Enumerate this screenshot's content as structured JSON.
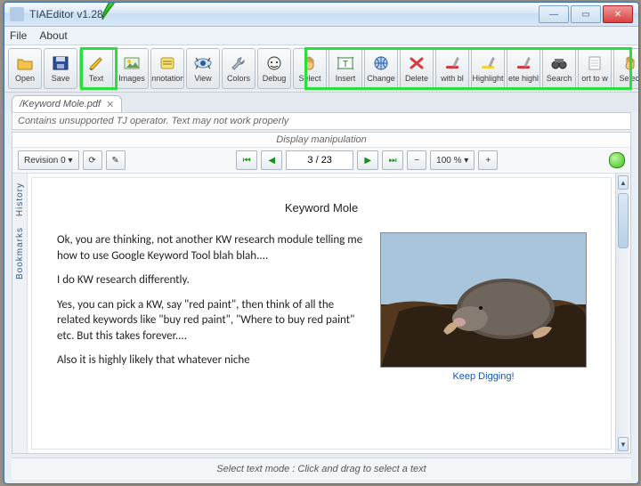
{
  "window": {
    "title": "TIAEditor v1.28",
    "buttons": {
      "min": "—",
      "max": "▭",
      "close": "✕"
    }
  },
  "menu": {
    "file": "File",
    "about": "About"
  },
  "toolbar": {
    "primary": [
      {
        "id": "open",
        "label": "Open",
        "icon": "folder"
      },
      {
        "id": "save",
        "label": "Save",
        "icon": "floppy"
      },
      {
        "id": "text",
        "label": "Text",
        "icon": "pencil"
      },
      {
        "id": "images",
        "label": "Images",
        "icon": "picture"
      },
      {
        "id": "annotations",
        "label": "Annotations",
        "icon": "note"
      },
      {
        "id": "view",
        "label": "View",
        "icon": "eye"
      },
      {
        "id": "colors",
        "label": "Colors",
        "icon": "wrench"
      },
      {
        "id": "debug",
        "label": "Debug",
        "icon": "face"
      }
    ],
    "secondary": [
      {
        "id": "select",
        "label": "Select",
        "icon": "hand"
      },
      {
        "id": "insert",
        "label": "Insert",
        "icon": "textbox"
      },
      {
        "id": "change",
        "label": "Change",
        "icon": "globe"
      },
      {
        "id": "delete",
        "label": "Delete",
        "icon": "cross"
      },
      {
        "id": "withbl",
        "label": "with bl",
        "icon": "wand-red"
      },
      {
        "id": "highlight",
        "label": "Highlight",
        "icon": "wand-yel"
      },
      {
        "id": "dehighlight",
        "label": "ete highl",
        "icon": "wand-red"
      },
      {
        "id": "search",
        "label": "Search",
        "icon": "binoc"
      },
      {
        "id": "export",
        "label": "ort to w",
        "icon": "sheet"
      },
      {
        "id": "select2",
        "label": "Select",
        "icon": "hand"
      }
    ]
  },
  "tab": {
    "name": "/Keyword Mole.pdf",
    "close": "✕"
  },
  "warning": "Contains unsupported TJ operator. Text may not work properly",
  "display": {
    "heading": "Display manipulation",
    "revision_label": "Revision 0",
    "page_field": "3 / 23",
    "zoom_label": "100 %",
    "minus": "−",
    "plus": "+"
  },
  "sidetabs": {
    "history": "History",
    "bookmarks": "Bookmarks"
  },
  "document": {
    "title": "Keyword Mole",
    "paragraphs": [
      "Ok, you are thinking, not another KW research module telling me how to use Google Keyword Tool blah blah....",
      "I do KW research differently.",
      "Yes, you can pick a KW, say \"red paint\", then think of all the related keywords like \"buy red paint\", \"Where to buy red paint\" etc. But this takes forever....",
      "Also it is highly likely that whatever niche"
    ],
    "image_caption": "Keep Digging!"
  },
  "status": "Select text mode : Click and drag to select a text"
}
